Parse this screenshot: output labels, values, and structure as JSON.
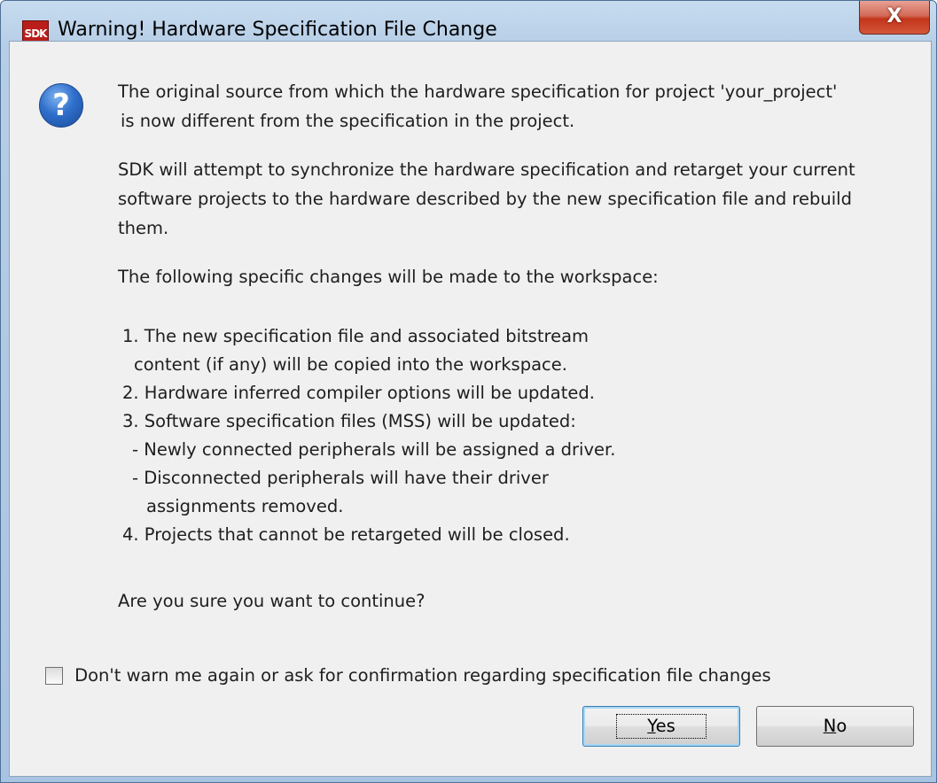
{
  "window": {
    "app_icon_text": "SDK",
    "title": "Warning! Hardware Specification File Change",
    "close_glyph": "X"
  },
  "dialog": {
    "icon": "question-icon",
    "message": {
      "line1": "The original source from which the hardware specification for project 'your_project'",
      "line2": "is now different from the specification in the project.",
      "para2_line1": "SDK will attempt to synchronize the hardware specification and retarget your current",
      "para2_line2": "software projects to the hardware described by the new specification file and rebuild",
      "para2_line3": "them.",
      "para3": "The following specific changes will be made to the workspace:",
      "items": [
        "1. The new specification file and associated bitstream",
        "    content (if any) will be copied into the workspace.",
        "2. Hardware inferred compiler options will be updated.",
        "3. Software specification files (MSS) will be updated:",
        "    - Newly connected peripherals will be assigned a driver.",
        "    - Disconnected peripherals will have their driver",
        "      assignments removed.",
        "4. Projects that cannot be retargeted will be closed."
      ],
      "confirm": "Are you sure you want to continue?"
    },
    "checkbox_label": "Don't warn me again or ask for confirmation regarding specification file changes",
    "checkbox_checked": false,
    "yes_mnemonic": "Y",
    "yes_rest": "es",
    "no_mnemonic": "N",
    "no_rest": "o"
  }
}
